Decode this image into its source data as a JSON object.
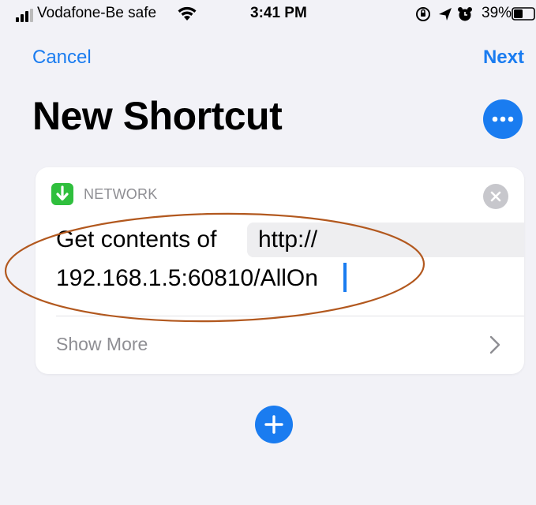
{
  "status_bar": {
    "carrier": "Vodafone-Be safe",
    "time": "3:41 PM",
    "battery": "39%"
  },
  "nav": {
    "cancel_label": "Cancel",
    "next_label": "Next"
  },
  "page": {
    "title": "New Shortcut"
  },
  "action": {
    "category": "NETWORK",
    "label": "Get contents of",
    "url_line1": "http://",
    "url_line2": "192.168.1.5:60810/AllOn"
  },
  "show_more_label": "Show More",
  "colors": {
    "accent": "#1a7cf0",
    "network_icon": "#2fbf3d",
    "annotation": "#b2581e"
  },
  "icons": [
    "signal-icon",
    "wifi-icon",
    "screen-rotation-lock-icon",
    "location-icon",
    "alarm-icon",
    "battery-icon",
    "more-icon",
    "download-icon",
    "close-icon",
    "chevron-right-icon",
    "plus-icon"
  ]
}
